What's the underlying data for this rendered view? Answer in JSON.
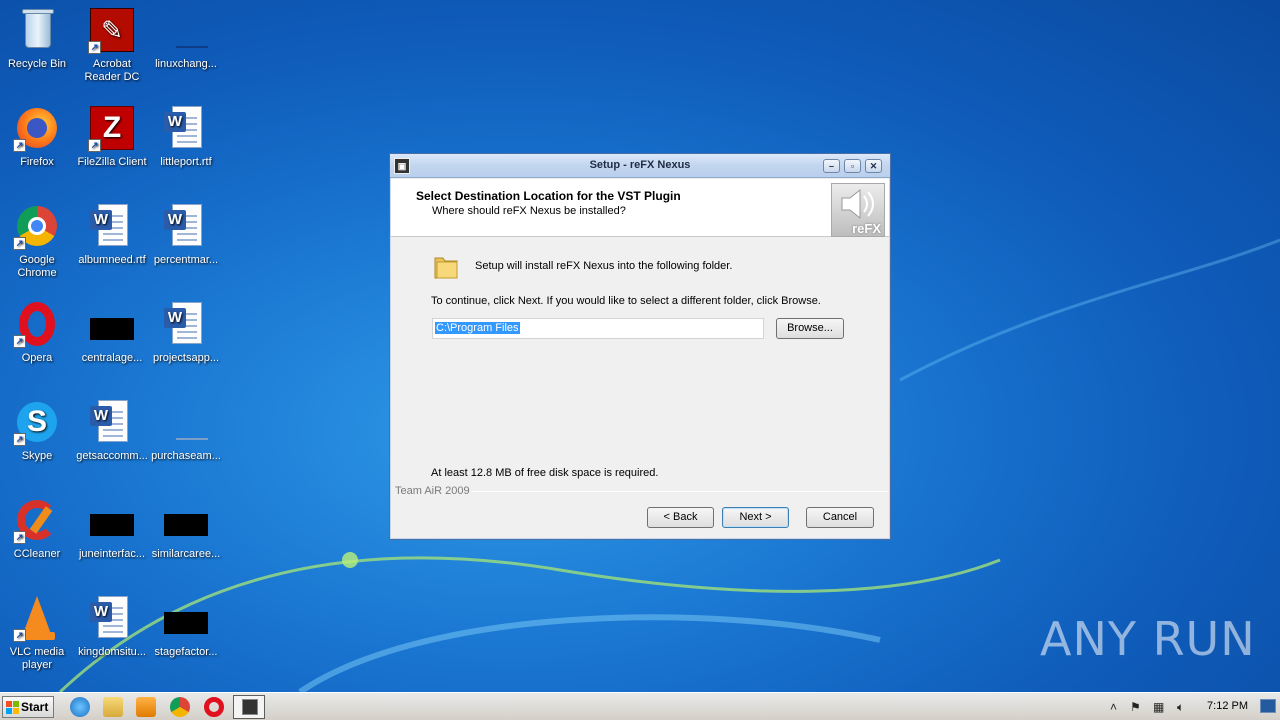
{
  "desktop": {
    "icons": [
      {
        "label": "Recycle Bin"
      },
      {
        "label": "Acrobat Reader DC"
      },
      {
        "label": "linuxchang..."
      },
      {
        "label": "Firefox"
      },
      {
        "label": "FileZilla Client"
      },
      {
        "label": "littleport.rtf"
      },
      {
        "label": "Google Chrome"
      },
      {
        "label": "albumneed.rtf"
      },
      {
        "label": "percentmar..."
      },
      {
        "label": "Opera"
      },
      {
        "label": "centralage..."
      },
      {
        "label": "projectsapp..."
      },
      {
        "label": "Skype"
      },
      {
        "label": "getsaccomm..."
      },
      {
        "label": "purchaseam..."
      },
      {
        "label": "CCleaner"
      },
      {
        "label": "juneinterfac..."
      },
      {
        "label": "similarcaree..."
      },
      {
        "label": "VLC media player"
      },
      {
        "label": "kingdomsitu..."
      },
      {
        "label": "stagefactor..."
      }
    ]
  },
  "dialog": {
    "title": "Setup - reFX Nexus",
    "header_title": "Select Destination Location for the VST Plugin",
    "header_subtitle": "Where should reFX Nexus be installed?",
    "logo_text": "reFX",
    "install_text": "Setup will install reFX Nexus into the following folder.",
    "continue_text": "To continue, click Next. If you would like to select a different folder, click Browse.",
    "path_value": "C:\\Program Files",
    "browse_label": "Browse...",
    "disk_space_text": "At least 12.8 MB of free disk space is required.",
    "brand_text": "Team AiR 2009",
    "back_label": "< Back",
    "next_label": "Next >",
    "cancel_label": "Cancel"
  },
  "taskbar": {
    "start_label": "Start",
    "clock": "7:12 PM"
  },
  "watermark": "ANY RUN",
  "colors": {
    "accent": "#3399ff",
    "desktop": "#1a77d2"
  }
}
